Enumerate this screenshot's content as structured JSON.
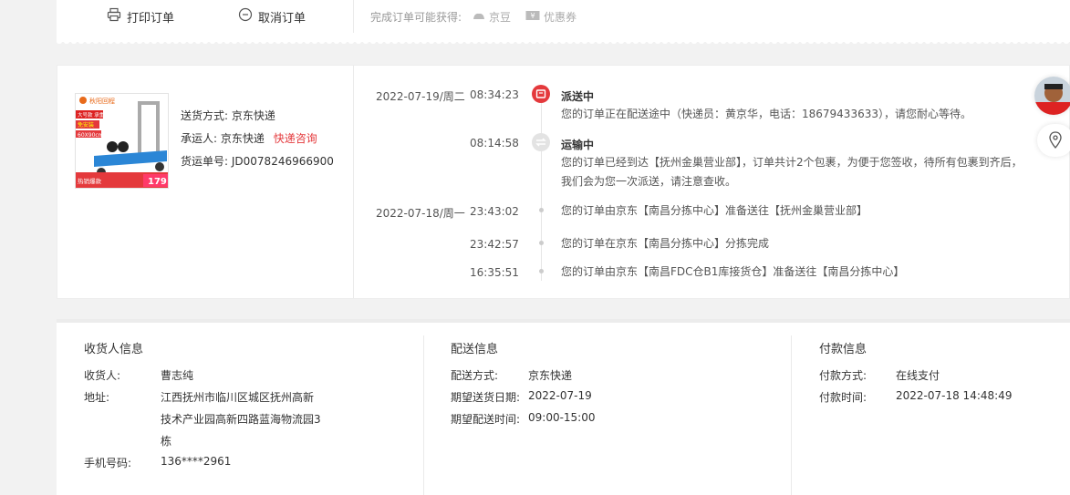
{
  "top": {
    "print_label": "打印订单",
    "cancel_label": "取消订单",
    "gain_label": "完成订单可能获得:",
    "gain_items": [
      "京豆",
      "优惠券"
    ]
  },
  "shipment": {
    "delivery_method_label": "送货方式:",
    "delivery_method": "京东快递",
    "carrier_label": "承运人:",
    "carrier": "京东快递",
    "carrier_link": "快递咨询",
    "tracking_label": "货运单号:",
    "tracking_no": "JD0078246966900",
    "product_image_text": {
      "brand": "秋阳回程",
      "promo1": "大号款 承重600斤",
      "size": "60X90cm",
      "tag": "免安装",
      "hot": "热销爆款",
      "price": "179"
    }
  },
  "timeline": [
    {
      "date": "2022-07-19/周二",
      "time": "08:34:23",
      "title": "派送中",
      "text": [
        "您的订单正在配送途中（快递员：黄京华，电话：18679433633），请您耐心等待。"
      ],
      "status": "active"
    },
    {
      "date": "",
      "time": "08:14:58",
      "title": "运输中",
      "text": [
        "您的订单已经到达【抚州金巢营业部】，订单共计2个包裹，为便于您签收，待所有包裹到齐后，",
        "我们会为您一次派送，请注意查收。"
      ],
      "status": "transit"
    },
    {
      "date": "2022-07-18/周一",
      "time": "23:43:02",
      "title": "",
      "text": [
        "您的订单由京东【南昌分拣中心】准备送往【抚州金巢营业部】"
      ],
      "status": "dot"
    },
    {
      "date": "",
      "time": "23:42:57",
      "title": "",
      "text": [
        "您的订单在京东【南昌分拣中心】分拣完成"
      ],
      "status": "dot"
    },
    {
      "date": "",
      "time": "16:35:51",
      "title": "",
      "text": [
        "您的订单由京东【南昌FDC仓B1库接货仓】准备送往【南昌分拣中心】"
      ],
      "status": "dot"
    }
  ],
  "receiver": {
    "title": "收货人信息",
    "name_label": "收货人:",
    "name": "曹志纯",
    "address_label": "地址:",
    "address_lines": [
      "江西抚州市临川区城区抚州高新",
      "技术产业园高新四路蓝海物流园3",
      "栋"
    ],
    "phone_label": "手机号码:",
    "phone": "136****2961"
  },
  "delivery": {
    "title": "配送信息",
    "method_label": "配送方式:",
    "method": "京东快递",
    "date_label": "期望送货日期:",
    "date": "2022-07-19",
    "time_label": "期望配送时间:",
    "time": "09:00-15:00"
  },
  "payment": {
    "title": "付款信息",
    "method_label": "付款方式:",
    "method": "在线支付",
    "time_label": "付款时间:",
    "time": "2022-07-18 14:48:49"
  },
  "colors": {
    "accent": "#e4393c",
    "grey_text": "#999999"
  }
}
